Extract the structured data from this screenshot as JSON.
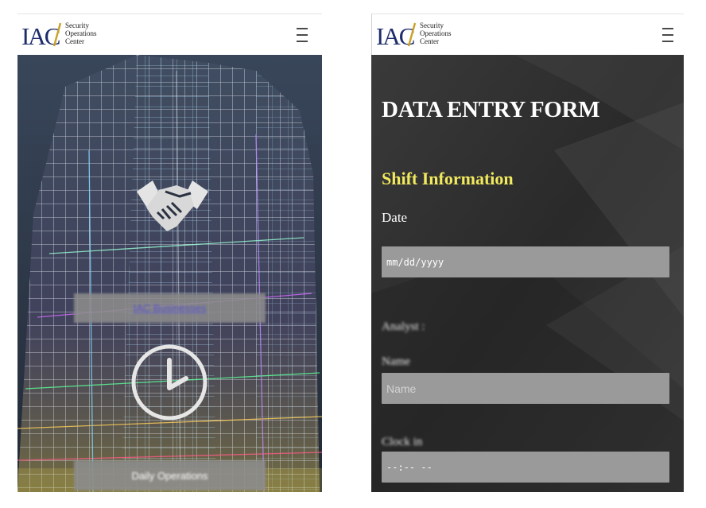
{
  "brand": {
    "logo_text": "IAC",
    "tagline": [
      "Security",
      "Operations",
      "Center"
    ]
  },
  "home": {
    "buttons": [
      {
        "label": "IAC Businesses",
        "icon": "handshake-icon"
      },
      {
        "label": "Daily Operations",
        "icon": "clock-icon"
      }
    ]
  },
  "form": {
    "title": "DATA ENTRY FORM",
    "section": "Shift Information",
    "date_label": "Date",
    "date_placeholder": "mm/dd/yyyy",
    "analyst_label": "Analyst :",
    "name_label": "Name",
    "name_placeholder": "Name",
    "clockin_label": "Clock in",
    "time_placeholder": "--:-- --"
  },
  "colors": {
    "section_heading": "#f2ea5e",
    "input_bg": "#9a9a9a",
    "form_bg": "#2d2d2d",
    "link_text": "#5b55c9"
  }
}
